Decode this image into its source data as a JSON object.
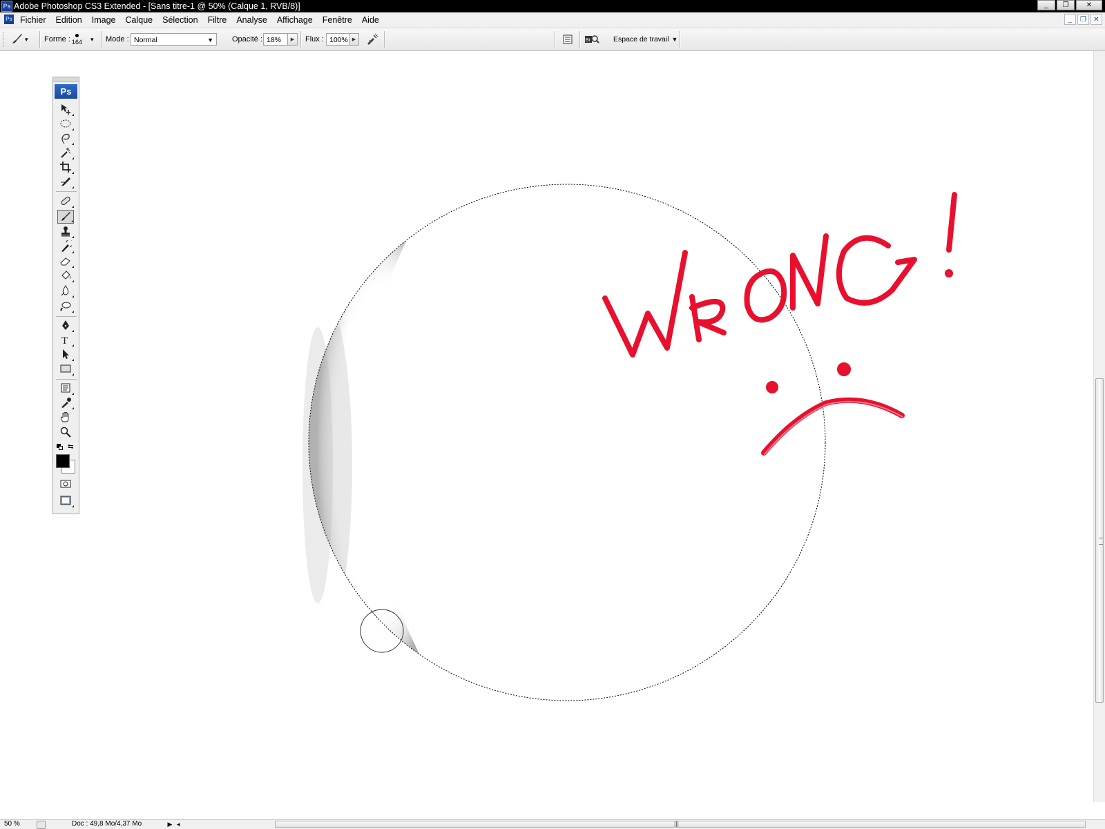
{
  "window": {
    "app_icon": "Ps",
    "title": "Adobe Photoshop CS3 Extended - [Sans titre-1 @ 50% (Calque 1, RVB/8)]",
    "buttons": {
      "minimize": "_",
      "restore": "❐",
      "close": "✕"
    }
  },
  "menubar": {
    "doc_icon": "Ps",
    "items": [
      "Fichier",
      "Edition",
      "Image",
      "Calque",
      "Sélection",
      "Filtre",
      "Analyse",
      "Affichage",
      "Fenêtre",
      "Aide"
    ],
    "doc_buttons": {
      "minimize": "_",
      "restore": "❐",
      "close": "✕"
    }
  },
  "options": {
    "forme_label": "Forme :",
    "brush_size": "164",
    "mode_label": "Mode :",
    "mode_value": "Normal",
    "opacity_label": "Opacité :",
    "opacity_value": "18%",
    "flux_label": "Flux :",
    "flux_value": "100%",
    "workspace_label": "Espace de travail"
  },
  "toolbox": {
    "logo": "Ps",
    "tools": [
      {
        "name": "move-tool-icon"
      },
      {
        "name": "elliptical-marquee-tool-icon"
      },
      {
        "name": "lasso-tool-icon"
      },
      {
        "name": "magic-wand-tool-icon"
      },
      {
        "name": "crop-tool-icon"
      },
      {
        "name": "slice-tool-icon"
      },
      {
        "name": "healing-brush-tool-icon"
      },
      {
        "name": "brush-tool-icon",
        "active": true
      },
      {
        "name": "clone-stamp-tool-icon"
      },
      {
        "name": "history-brush-tool-icon"
      },
      {
        "name": "eraser-tool-icon"
      },
      {
        "name": "paint-bucket-tool-icon"
      },
      {
        "name": "blur-tool-icon"
      },
      {
        "name": "dodge-tool-icon"
      },
      {
        "name": "pen-tool-icon"
      },
      {
        "name": "type-tool-icon"
      },
      {
        "name": "path-selection-tool-icon"
      },
      {
        "name": "rectangle-tool-icon"
      },
      {
        "name": "notes-tool-icon"
      },
      {
        "name": "eyedropper-tool-icon"
      },
      {
        "name": "hand-tool-icon"
      },
      {
        "name": "zoom-tool-icon"
      }
    ],
    "foreground_color": "#000000",
    "background_color": "#ffffff"
  },
  "canvas": {
    "annotation_text": "WRONG !",
    "annotation_color": "#e8102e"
  },
  "status": {
    "zoom": "50 %",
    "doc_info": "Doc : 49,8 Mo/4,37 Mo",
    "arrow": "▶"
  },
  "colors": {
    "titlebar": "#000000",
    "menubar": "#f0f0f0",
    "ps_blue": "#1c4fa8",
    "marker_red": "#e8102e"
  }
}
